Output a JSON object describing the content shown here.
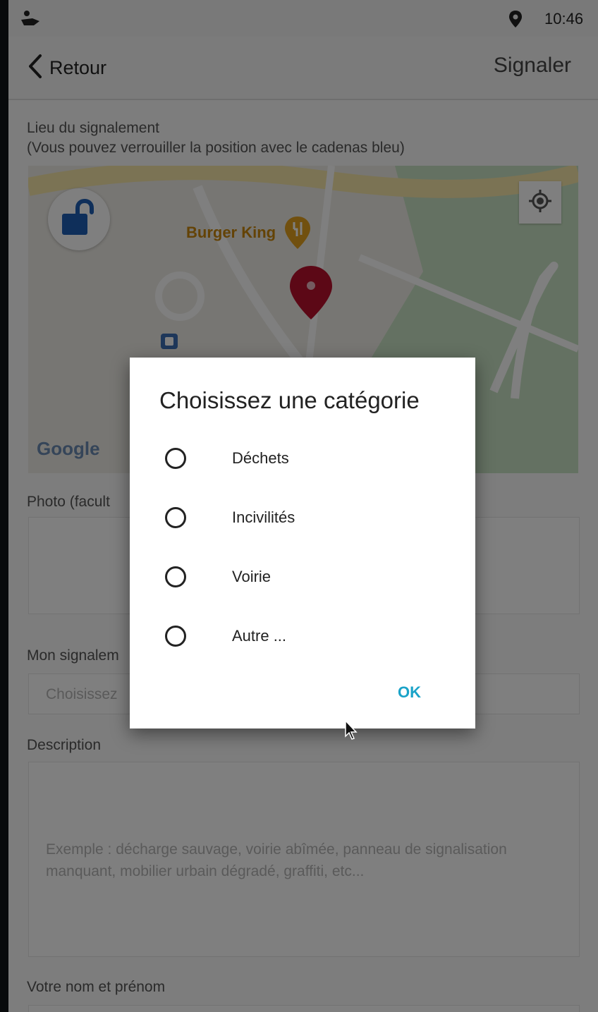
{
  "status_bar": {
    "time": "10:46"
  },
  "nav": {
    "back_label": "Retour",
    "title": "Signaler"
  },
  "form": {
    "location_label": "Lieu du signalement",
    "location_hint": "(Vous pouvez verrouiller la position avec le cadenas bleu)",
    "map": {
      "poi_name": "Burger King",
      "google_logo": "Google"
    },
    "photo_label": "Photo (facult",
    "report_label": "Mon signalem",
    "report_placeholder": "Choisissez",
    "description_label": "Description",
    "description_placeholder": "Exemple : décharge sauvage, voirie abîmée, panneau de signalisation manquant, mobilier urbain dégradé, graffiti, etc...",
    "name_label": "Votre nom et prénom"
  },
  "dialog": {
    "title": "Choisissez une catégorie",
    "options": [
      {
        "label": "Déchets"
      },
      {
        "label": "Incivilités"
      },
      {
        "label": "Voirie"
      },
      {
        "label": "Autre ..."
      }
    ],
    "ok_label": "OK"
  },
  "colors": {
    "lock": "#1f5fb4",
    "pin": "#b8102c",
    "accent": "#1aa3c8"
  }
}
